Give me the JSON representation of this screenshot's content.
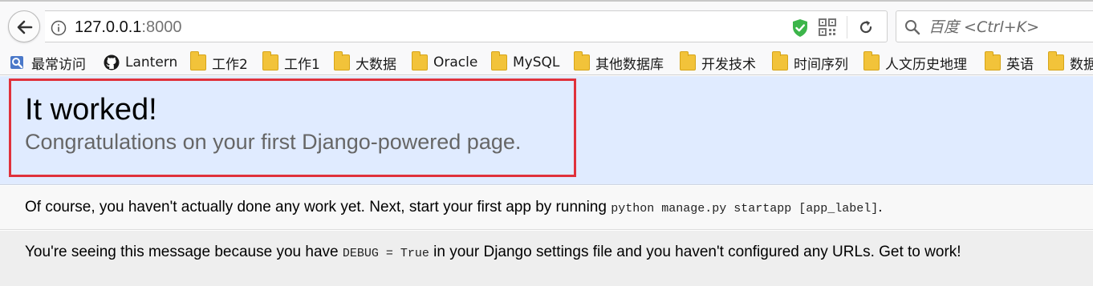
{
  "browser": {
    "url_host": "127.0.0.1",
    "url_port": ":8000",
    "search_placeholder": "百度 <Ctrl+K>",
    "bookmarks": [
      {
        "label": "最常访问",
        "icon": "most-visited-icon"
      },
      {
        "label": "Lantern",
        "icon": "github-icon"
      },
      {
        "label": "工作2",
        "icon": "folder-icon"
      },
      {
        "label": "工作1",
        "icon": "folder-icon"
      },
      {
        "label": "大数据",
        "icon": "folder-icon"
      },
      {
        "label": "Oracle",
        "icon": "folder-icon"
      },
      {
        "label": "MySQL",
        "icon": "folder-icon"
      },
      {
        "label": "其他数据库",
        "icon": "folder-icon"
      },
      {
        "label": "开发技术",
        "icon": "folder-icon"
      },
      {
        "label": "时间序列",
        "icon": "folder-icon"
      },
      {
        "label": "人文历史地理",
        "icon": "folder-icon"
      },
      {
        "label": "英语",
        "icon": "folder-icon"
      },
      {
        "label": "数据",
        "icon": "folder-icon"
      }
    ]
  },
  "summary": {
    "title": "It worked!",
    "subtitle": "Congratulations on your first Django-powered page."
  },
  "instructions": {
    "text_before": "Of course, you haven't actually done any work yet. Next, start your first app by running ",
    "code": "python manage.py startapp [app_label]",
    "text_after": "."
  },
  "explanation": {
    "text_before": "You're seeing this message because you have ",
    "code": "DEBUG = True",
    "text_after": " in your Django settings file and you haven't configured any URLs. Get to work!"
  },
  "colors": {
    "summary_bg": "#e0ebff",
    "highlight_border": "#e0313b",
    "subtitle": "#666666",
    "folder": "#f2c33a"
  }
}
